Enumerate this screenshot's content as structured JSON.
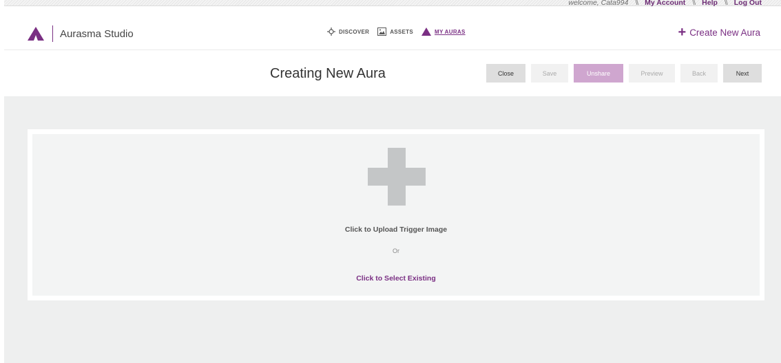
{
  "util": {
    "welcome": "welcome, Cata994",
    "sep": "\\\\",
    "my_account": "My Account",
    "help": "Help",
    "logout": "Log Out"
  },
  "brand": {
    "name": "Aurasma Studio",
    "icon": "aurasma-logo-icon",
    "color": "#7a2f83"
  },
  "nav": {
    "discover": {
      "label": "DISCOVER",
      "icon": "crosshair-icon"
    },
    "assets": {
      "label": "ASSETS",
      "icon": "image-icon"
    },
    "my_auras": {
      "label": "MY AURAS",
      "icon": "aurasma-logo-icon",
      "active": true
    }
  },
  "create": {
    "label": "Create New Aura",
    "icon": "plus-icon"
  },
  "page": {
    "title": "Creating New Aura"
  },
  "actions": {
    "close": "Close",
    "save": "Save",
    "unshare": "Unshare",
    "preview": "Preview",
    "back": "Back",
    "next": "Next"
  },
  "upload": {
    "upload_label": "Click to Upload Trigger Image",
    "or_label": "Or",
    "select_label": "Click to Select Existing",
    "icon": "plus-icon"
  },
  "colors": {
    "accent": "#7a2f83",
    "unshare_bg": "#cfa6cf",
    "content_bg": "#eeefef"
  }
}
